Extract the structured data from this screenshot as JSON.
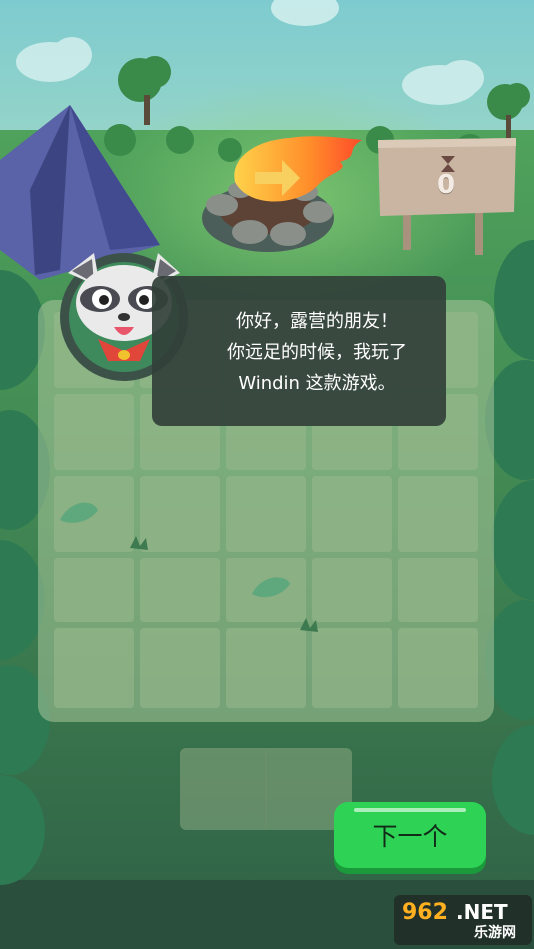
{
  "game": {
    "score": "0",
    "dialog_lines": [
      "你好，露营的朋友！",
      "你远足的时候，我玩了",
      "Windin 这款游戏。"
    ],
    "next_button_label": "下一个"
  },
  "watermark": {
    "logo_text": "962.NET",
    "sub_text": "乐游网"
  },
  "colors": {
    "grass": "#3f7a4f",
    "board": "#a9c79b",
    "dialog": "#32403a",
    "button": "#2ed356",
    "sign": "#c9b5a2"
  },
  "icons": [
    "raccoon-avatar-icon",
    "hourglass-icon",
    "fireball-arrow-icon",
    "tent-icon",
    "campfire-icon"
  ]
}
